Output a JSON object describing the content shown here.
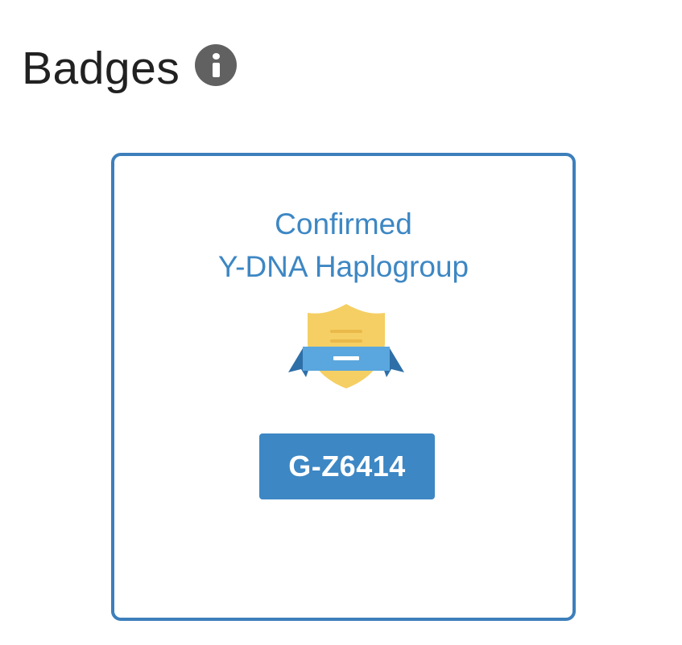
{
  "section": {
    "title": "Badges",
    "info_icon": "info-icon"
  },
  "badge": {
    "title_line1": "Confirmed",
    "title_line2": "Y-DNA Haplogroup",
    "emblem_icon": "shield-ribbon-icon",
    "haplogroup": "G-Z6414"
  },
  "colors": {
    "accent_blue": "#3d87c4",
    "card_border": "#3d7fbb",
    "shield_gold": "#f5cf63",
    "ribbon_light": "#5aa6de",
    "ribbon_dark": "#2e6fa8",
    "heading_text": "#212121",
    "info_icon_bg": "#616161"
  }
}
